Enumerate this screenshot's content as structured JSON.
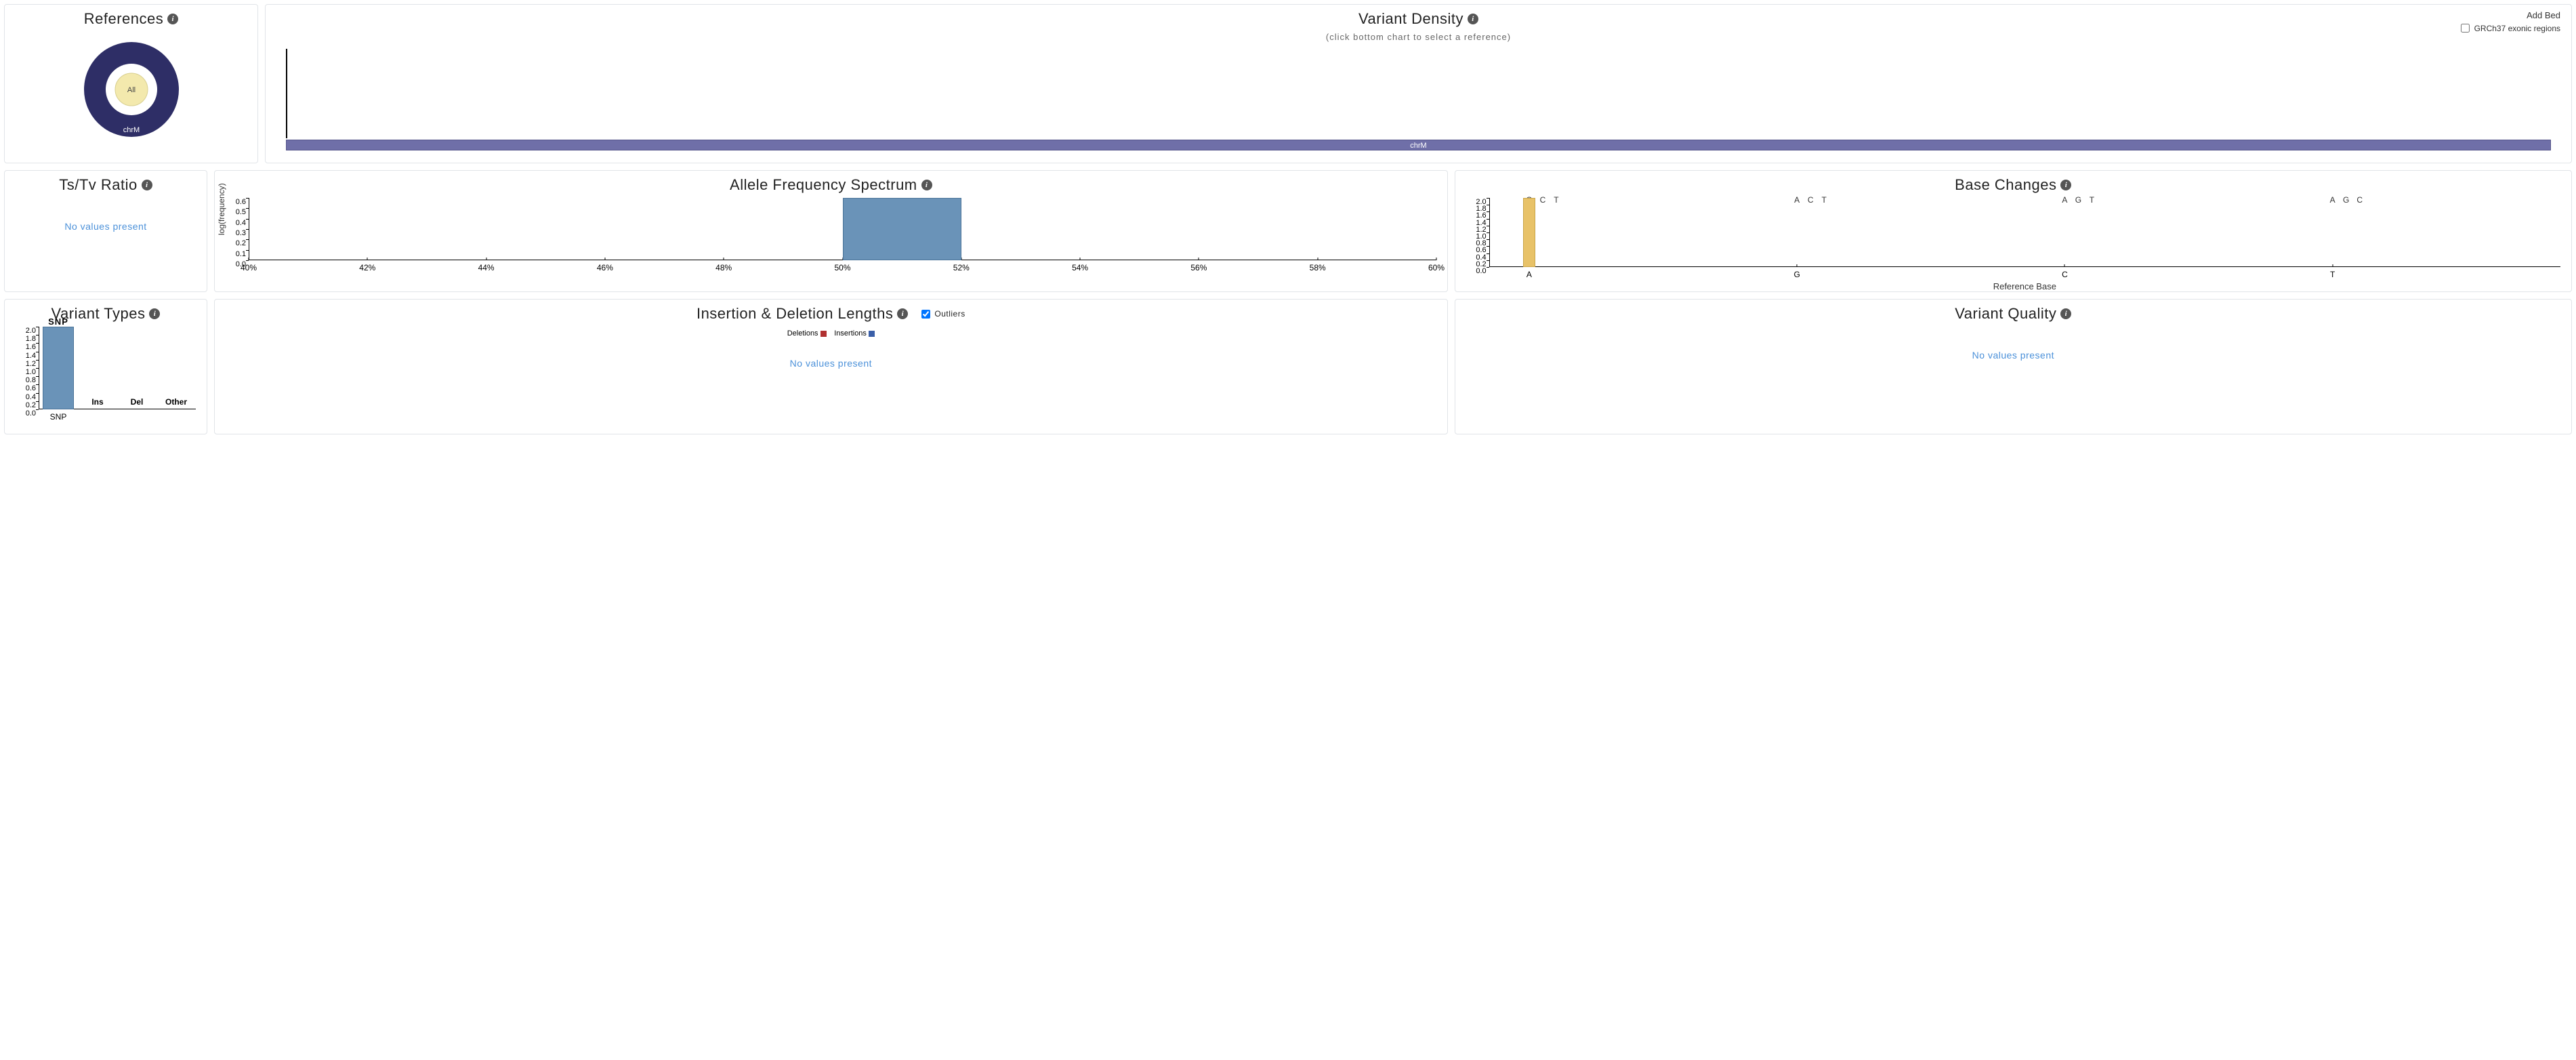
{
  "references": {
    "title": "References",
    "center_label": "All",
    "ring_label": "chrM"
  },
  "density": {
    "title": "Variant Density",
    "subtitle": "(click bottom chart to select a reference)",
    "add_bed": "Add Bed",
    "grch37_label": "GRCh37 exonic regions",
    "ref_band_label": "chrM"
  },
  "tstv": {
    "title": "Ts/Tv Ratio",
    "no_values": "No values present"
  },
  "afs": {
    "title": "Allele Frequency Spectrum"
  },
  "base": {
    "title": "Base Changes",
    "xlabel": "Reference Base"
  },
  "vtypes": {
    "title": "Variant Types"
  },
  "indel": {
    "title": "Insertion & Deletion Lengths",
    "outliers_label": "Outliers",
    "legend_del": "Deletions",
    "legend_ins": "Insertions",
    "no_values": "No values present"
  },
  "qual": {
    "title": "Variant Quality",
    "no_values": "No values present"
  },
  "chart_data": [
    {
      "name": "references",
      "type": "pie",
      "slices": [
        {
          "label": "chrM",
          "value": 1
        }
      ],
      "center_label": "All"
    },
    {
      "name": "variant_density",
      "type": "bar",
      "reference": "chrM",
      "note": "single reference band; density track empty"
    },
    {
      "name": "allele_frequency_spectrum",
      "type": "bar",
      "xlabel": "",
      "ylabel": "log(frequency)",
      "x_ticks": [
        "40%",
        "42%",
        "44%",
        "46%",
        "48%",
        "50%",
        "52%",
        "54%",
        "56%",
        "58%",
        "60%"
      ],
      "y_ticks": [
        0.0,
        0.1,
        0.2,
        0.3,
        0.4,
        0.5,
        0.6
      ],
      "bars": [
        {
          "bin": "50%-52%",
          "value": 0.6
        }
      ]
    },
    {
      "name": "base_changes",
      "type": "bar",
      "xlabel": "Reference Base",
      "ylabel": "",
      "categories": [
        "A",
        "G",
        "C",
        "T"
      ],
      "group_key_labels": {
        "A": [
          "G",
          "C",
          "T"
        ],
        "G": [
          "A",
          "C",
          "T"
        ],
        "C": [
          "A",
          "G",
          "T"
        ],
        "T": [
          "A",
          "G",
          "C"
        ]
      },
      "y_ticks": [
        0.0,
        0.2,
        0.4,
        0.6,
        0.8,
        1.0,
        1.2,
        1.4,
        1.6,
        1.8,
        2.0
      ],
      "bars": [
        {
          "ref": "A",
          "alt": "G",
          "value": 2.0
        }
      ]
    },
    {
      "name": "variant_types",
      "type": "bar",
      "categories": [
        "SNP",
        "Ins",
        "Del",
        "Other"
      ],
      "y_ticks": [
        0.0,
        0.2,
        0.4,
        0.6,
        0.8,
        1.0,
        1.2,
        1.4,
        1.6,
        1.8,
        2.0
      ],
      "values": [
        2.0,
        0,
        0,
        0
      ]
    },
    {
      "name": "indel_lengths",
      "type": "bar",
      "series": [
        {
          "name": "Deletions",
          "values": []
        },
        {
          "name": "Insertions",
          "values": []
        }
      ],
      "note": "No values present"
    },
    {
      "name": "variant_quality",
      "type": "bar",
      "note": "No values present"
    }
  ]
}
